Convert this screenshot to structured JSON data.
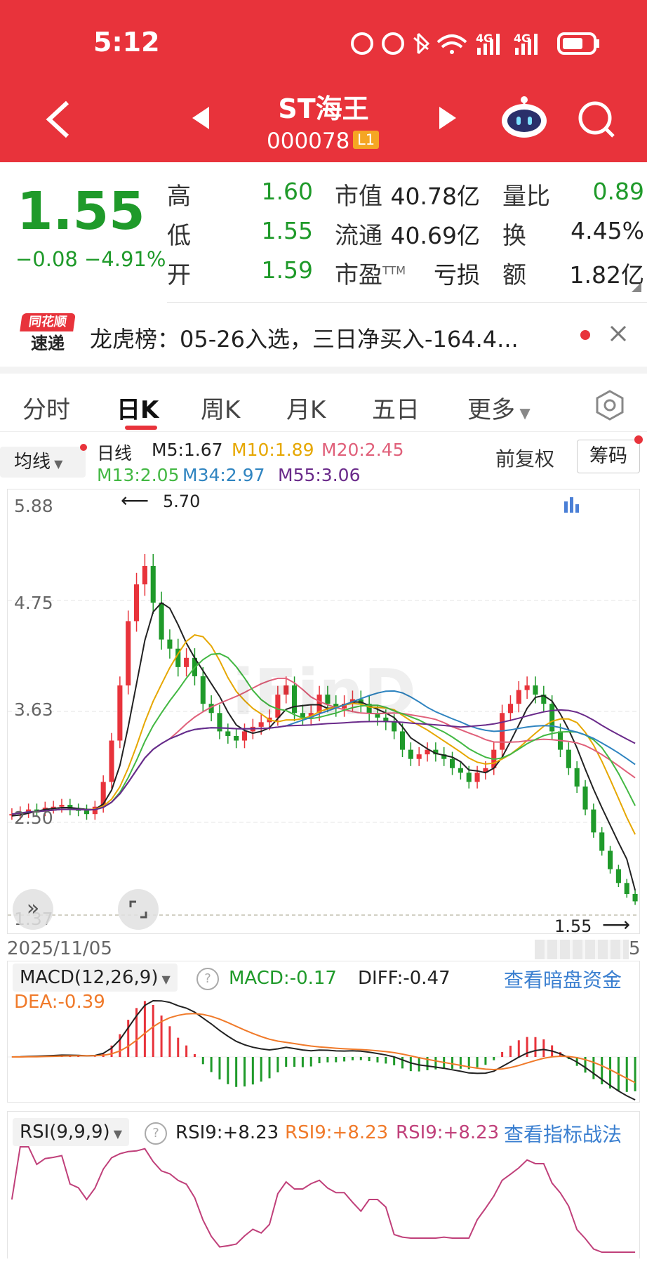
{
  "status_bar": {
    "time": "5:12"
  },
  "header": {
    "name": "ST海王",
    "code": "000078",
    "level": "L1"
  },
  "quote": {
    "price": "1.55",
    "change": "−0.08",
    "change_pct": "−4.91%",
    "high_label": "高",
    "high": "1.60",
    "low_label": "低",
    "low": "1.55",
    "open_label": "开",
    "open": "1.59",
    "mcap_label": "市值",
    "mcap": "40.78亿",
    "float_label": "流通",
    "float": "40.69亿",
    "pe_label": "市盈",
    "pe_sup": "TTM",
    "pe": "亏损",
    "vr_label": "量比",
    "vr": "0.89",
    "turnover_label": "换",
    "turnover": "4.45%",
    "amount_label": "额",
    "amount": "1.82亿"
  },
  "news": {
    "logo_top": "同花顺",
    "logo_bottom": "速递",
    "text": "龙虎榜：05-26入选，三日净买入-164.4..."
  },
  "tabs": [
    "分时",
    "日K",
    "周K",
    "月K",
    "五日",
    "更多"
  ],
  "active_tab": 1,
  "kline": {
    "ma_button": "均线",
    "period": "日线",
    "ma_labels": [
      "M5:1.67",
      "M10:1.89",
      "M20:2.45",
      "M13:2.05",
      "M34:2.97",
      "M55:3.06"
    ],
    "ma_colors": [
      "#222222",
      "#e6a700",
      "#e0607a",
      "#43b843",
      "#2f84c0",
      "#6a2a8a"
    ],
    "fq": "前复权",
    "chips": "筹码",
    "y_ticks": [
      "5.88",
      "4.75",
      "3.63",
      "2.50",
      "1.37"
    ],
    "max_label": "5.70",
    "last_label": "1.55",
    "start_date": "2025/11/05",
    "end_date_fragment": "5"
  },
  "macd": {
    "title": "MACD(12,26,9)",
    "macd": "MACD:-0.17",
    "diff": "DIFF:-0.47",
    "dea": "DEA:-0.39",
    "link": "查看暗盘资金"
  },
  "rsi": {
    "title": "RSI(9,9,9)",
    "v1": "RSI9:+8.23",
    "v2": "RSI9:+8.23",
    "v3": "RSI9:+8.23",
    "link": "查看指标战法"
  },
  "chart_data": {
    "type": "line",
    "ylim": [
      1.37,
      5.88
    ],
    "close": [
      2.5,
      2.52,
      2.55,
      2.54,
      2.57,
      2.58,
      2.6,
      2.55,
      2.54,
      2.5,
      2.58,
      2.85,
      3.3,
      3.9,
      4.6,
      5.0,
      5.2,
      4.8,
      4.4,
      4.3,
      4.1,
      4.2,
      4.0,
      3.7,
      3.6,
      3.4,
      3.35,
      3.3,
      3.4,
      3.45,
      3.5,
      3.55,
      3.8,
      3.9,
      3.6,
      3.55,
      3.6,
      3.8,
      3.7,
      3.65,
      3.7,
      3.75,
      3.7,
      3.6,
      3.55,
      3.5,
      3.4,
      3.2,
      3.1,
      3.15,
      3.2,
      3.15,
      3.1,
      3.0,
      2.95,
      2.85,
      2.95,
      3.0,
      3.2,
      3.6,
      3.7,
      3.85,
      3.9,
      3.8,
      3.7,
      3.4,
      3.2,
      3.0,
      2.8,
      2.55,
      2.3,
      2.1,
      1.9,
      1.75,
      1.63,
      1.55
    ],
    "ma5": [
      2.48,
      2.49,
      2.51,
      2.53,
      2.55,
      2.56,
      2.57,
      2.57,
      2.56,
      2.55,
      2.55,
      2.61,
      2.76,
      3.03,
      3.45,
      3.92,
      4.39,
      4.7,
      4.8,
      4.74,
      4.56,
      4.36,
      4.2,
      4.06,
      3.92,
      3.78,
      3.61,
      3.47,
      3.41,
      3.38,
      3.4,
      3.44,
      3.54,
      3.64,
      3.67,
      3.68,
      3.69,
      3.69,
      3.65,
      3.66,
      3.69,
      3.72,
      3.72,
      3.68,
      3.64,
      3.6,
      3.55,
      3.45,
      3.33,
      3.27,
      3.21,
      3.16,
      3.14,
      3.12,
      3.07,
      2.98,
      2.97,
      2.95,
      3.0,
      3.12,
      3.29,
      3.47,
      3.65,
      3.77,
      3.79,
      3.73,
      3.59,
      3.42,
      3.22,
      2.99,
      2.77,
      2.57,
      2.38,
      2.19,
      2.01,
      1.67
    ]
  }
}
